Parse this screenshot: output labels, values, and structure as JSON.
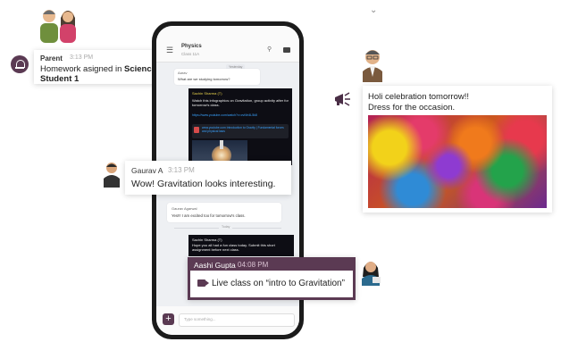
{
  "colors": {
    "accent": "#5b3a53",
    "dark_message": "#0d0d14",
    "link": "#3aa3ff"
  },
  "phone": {
    "header": {
      "title": "Physics",
      "subtitle": "Class 11A",
      "menu_icon": "hamburger-icon",
      "search_icon": "search-icon",
      "video_icon": "video-camera-icon"
    },
    "day_tag": "Yesterday",
    "msg1": {
      "name": "Aarav",
      "text": "What are we studying tomorrow?"
    },
    "msg2": {
      "name": "Sachin Sharma (T)",
      "text": "Watch this infographics on Gravitation, group activity after for tomorrow's class.",
      "link": "https://www.youtube.com/watch?v=cvf4rt4L5k8",
      "attachment": "www.youtube.com Introduction to Gravity | Fundamental forces and physical laws"
    },
    "msg3": {
      "name": "Gaurav Agarwal",
      "text": "Yes!!! I am excited too for tomorrow's class."
    },
    "separator": "Today",
    "msg4": {
      "name": "Sachin Sharma (T)",
      "text": "Hope you all had a fun class today. Submit this short assignment before next class."
    },
    "input_placeholder": "Type something...",
    "plus_label": "+"
  },
  "parent_card": {
    "name": "Parent",
    "time": "3:13 PM",
    "line1_prefix": "Homework asigned in ",
    "line1_bold": "Science to",
    "line2": "Student 1",
    "icon": "bell-icon"
  },
  "gaurav_card": {
    "name": "Gaurav A",
    "time": "3:13 PM",
    "text": "Wow! Gravitation looks interesting."
  },
  "aashi_card": {
    "name": "Aashi Gupta",
    "time": "04:08 PM",
    "text": "Live class on “intro to Gravitation”",
    "icon": "video-camera-icon"
  },
  "holi_card": {
    "line1": "Holi celebration tomorrow!!",
    "line2": "Dress for the occasion.",
    "icon": "megaphone-icon"
  }
}
